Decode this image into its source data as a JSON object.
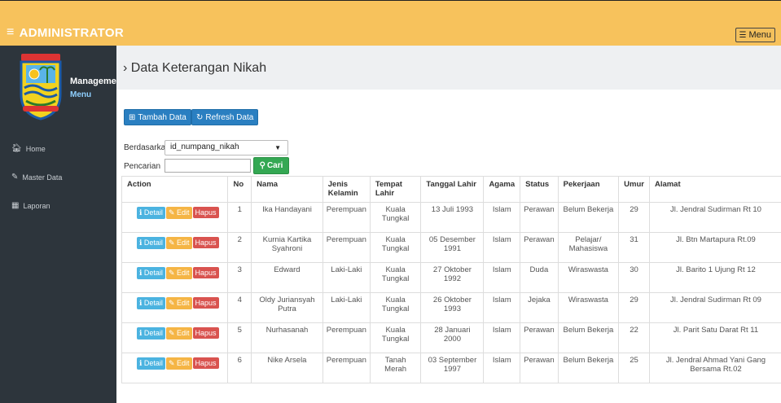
{
  "header": {
    "brand": "ADMINISTRATOR",
    "menu_label": "Menu"
  },
  "sidebar": {
    "management": "Management",
    "menu": "Menu",
    "items": [
      {
        "label": "Home",
        "icon": "home-icon"
      },
      {
        "label": "Master Data",
        "icon": "edit-icon"
      },
      {
        "label": "Laporan",
        "icon": "calendar-icon"
      }
    ]
  },
  "page": {
    "title": "› Data Keterangan Nikah"
  },
  "toolbar": {
    "add_label": "Tambah Data",
    "refresh_label": "Refresh Data"
  },
  "filter": {
    "by_label": "Berdasarkan:",
    "by_value": "id_numpang_nikah",
    "search_label": "Pencarian",
    "search_value": "",
    "search_button": "Cari"
  },
  "row_actions": {
    "detail": "Detail",
    "edit": "Edit",
    "delete": "Hapus"
  },
  "table": {
    "columns": [
      "Action",
      "No",
      "Nama",
      "Jenis Kelamin",
      "Tempat Lahir",
      "Tanggal Lahir",
      "Agama",
      "Status",
      "Pekerjaan",
      "Umur",
      "Alamat"
    ],
    "rows": [
      [
        "1",
        "Ika Handayani",
        "Perempuan",
        "Kuala Tungkal",
        "13 Juli 1993",
        "Islam",
        "Perawan",
        "Belum Bekerja",
        "29",
        "Jl. Jendral Sudirman Rt 10"
      ],
      [
        "2",
        "Kurnia Kartika Syahroni",
        "Perempuan",
        "Kuala Tungkal",
        "05 Desember 1991",
        "Islam",
        "Perawan",
        "Pelajar/ Mahasiswa",
        "31",
        "Jl. Btn Martapura Rt.09"
      ],
      [
        "3",
        "Edward",
        "Laki-Laki",
        "Kuala Tungkal",
        "27 Oktober 1992",
        "Islam",
        "Duda",
        "Wiraswasta",
        "30",
        "Jl. Barito 1 Ujung Rt 12"
      ],
      [
        "4",
        "Oldy Juriansyah Putra",
        "Laki-Laki",
        "Kuala Tungkal",
        "26 Oktober 1993",
        "Islam",
        "Jejaka",
        "Wiraswasta",
        "29",
        "Jl. Jendral Sudirman Rt 09"
      ],
      [
        "5",
        "Nurhasanah",
        "Perempuan",
        "Kuala Tungkal",
        "28 Januari 2000",
        "Islam",
        "Perawan",
        "Belum Bekerja",
        "22",
        "Jl. Parit Satu Darat Rt 11"
      ],
      [
        "6",
        "Nike Arsela",
        "Perempuan",
        "Tanah Merah",
        "03 September 1997",
        "Islam",
        "Perawan",
        "Belum Bekerja",
        "25",
        "Jl. Jendral Ahmad Yani Gang Bersama Rt.02"
      ]
    ]
  },
  "colors": {
    "topbar": "#f7c25c",
    "sidebar": "#2d353c",
    "primary": "#2a7fc1",
    "success": "#34a853",
    "info": "#4bb3e0",
    "warning": "#f5b545",
    "danger": "#d9534f"
  }
}
